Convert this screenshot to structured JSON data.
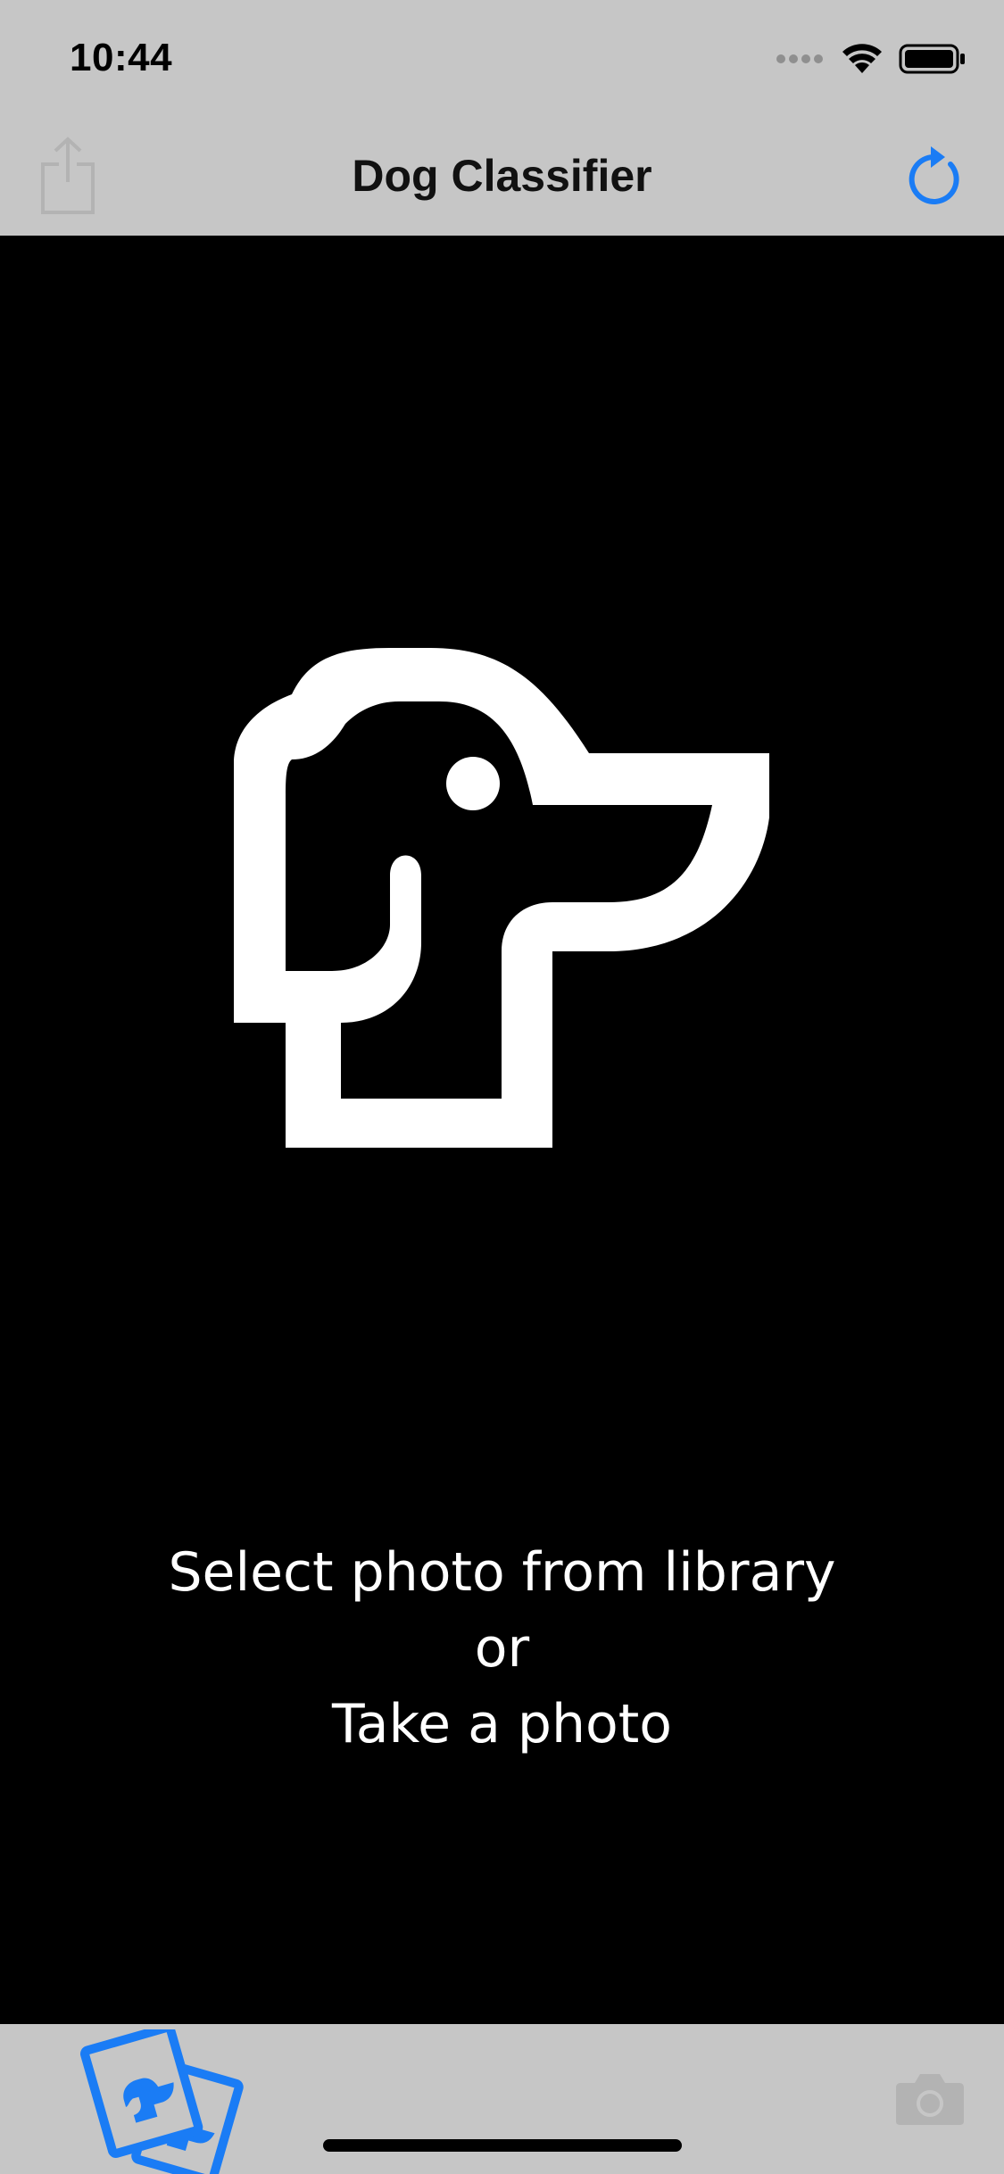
{
  "status_bar": {
    "time": "10:44",
    "icons": [
      "signal-dots-icon",
      "wifi-icon",
      "battery-icon"
    ]
  },
  "nav": {
    "title": "Dog Classifier",
    "left_button_icon": "share-icon",
    "right_button_icon": "refresh-icon"
  },
  "main": {
    "logo_icon": "dog-head-icon",
    "prompt_lines": [
      "Select photo from library",
      "or",
      "Take a photo"
    ]
  },
  "toolbar": {
    "left_button_icon": "photo-library-icon",
    "right_button_icon": "camera-icon"
  },
  "colors": {
    "bar_background": "#c6c6c6",
    "accent": "#1a7cf5",
    "disabled_icon": "#b3b3b3",
    "main_background": "#000000",
    "text_on_dark": "#ffffff"
  }
}
